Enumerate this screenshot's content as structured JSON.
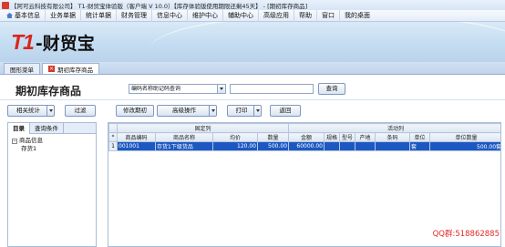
{
  "window": {
    "title": "【阿可云科技有限公司】 T1-财贸宝体验版（客户端 V 10.0）【库存体验版使用期限还剩45天】 - [期初库存商品]"
  },
  "menu": {
    "items": [
      "基本信息",
      "业务单据",
      "统计单据",
      "财务管理",
      "信息中心",
      "维护中心",
      "辅助中心",
      "高级应用",
      "帮助",
      "窗口",
      "我的桌面"
    ]
  },
  "brand": {
    "logo_t1": "T1",
    "logo_name": "-财贸宝"
  },
  "tabs": [
    {
      "label": "图形菜单"
    },
    {
      "label": "期初库存商品"
    }
  ],
  "page": {
    "title": "期初库存商品"
  },
  "search": {
    "mode_selected": "编码名称助记码查询",
    "query_label": "查询"
  },
  "toolbar": {
    "related_stats": "相关统计",
    "filter": "过滤",
    "modify_period": "修改期初",
    "advanced_ops": "高级操作",
    "print": "打印",
    "back": "返回"
  },
  "left_panel": {
    "tabs": [
      "目录",
      "查询条件"
    ],
    "tree_root": "商品信息",
    "tree_child": "存货1"
  },
  "grid": {
    "group_fixed": "固定列",
    "group_active": "活动列",
    "columns": [
      "*",
      "商品编码",
      "商品名称",
      "均价",
      "数量",
      "金额",
      "规格",
      "型号",
      "产地",
      "条码",
      "单位",
      "单位数量"
    ],
    "rows": [
      {
        "rowno": "1",
        "code": "001001",
        "name": "存货1下级货品",
        "avg_price": "120.00",
        "qty": "500.00",
        "amount": "60000.00",
        "spec": "",
        "model": "",
        "origin": "",
        "barcode": "",
        "unit": "套",
        "unit_qty": "500.00套"
      }
    ]
  },
  "watermark": {
    "text": "QQ群:518862885"
  }
}
